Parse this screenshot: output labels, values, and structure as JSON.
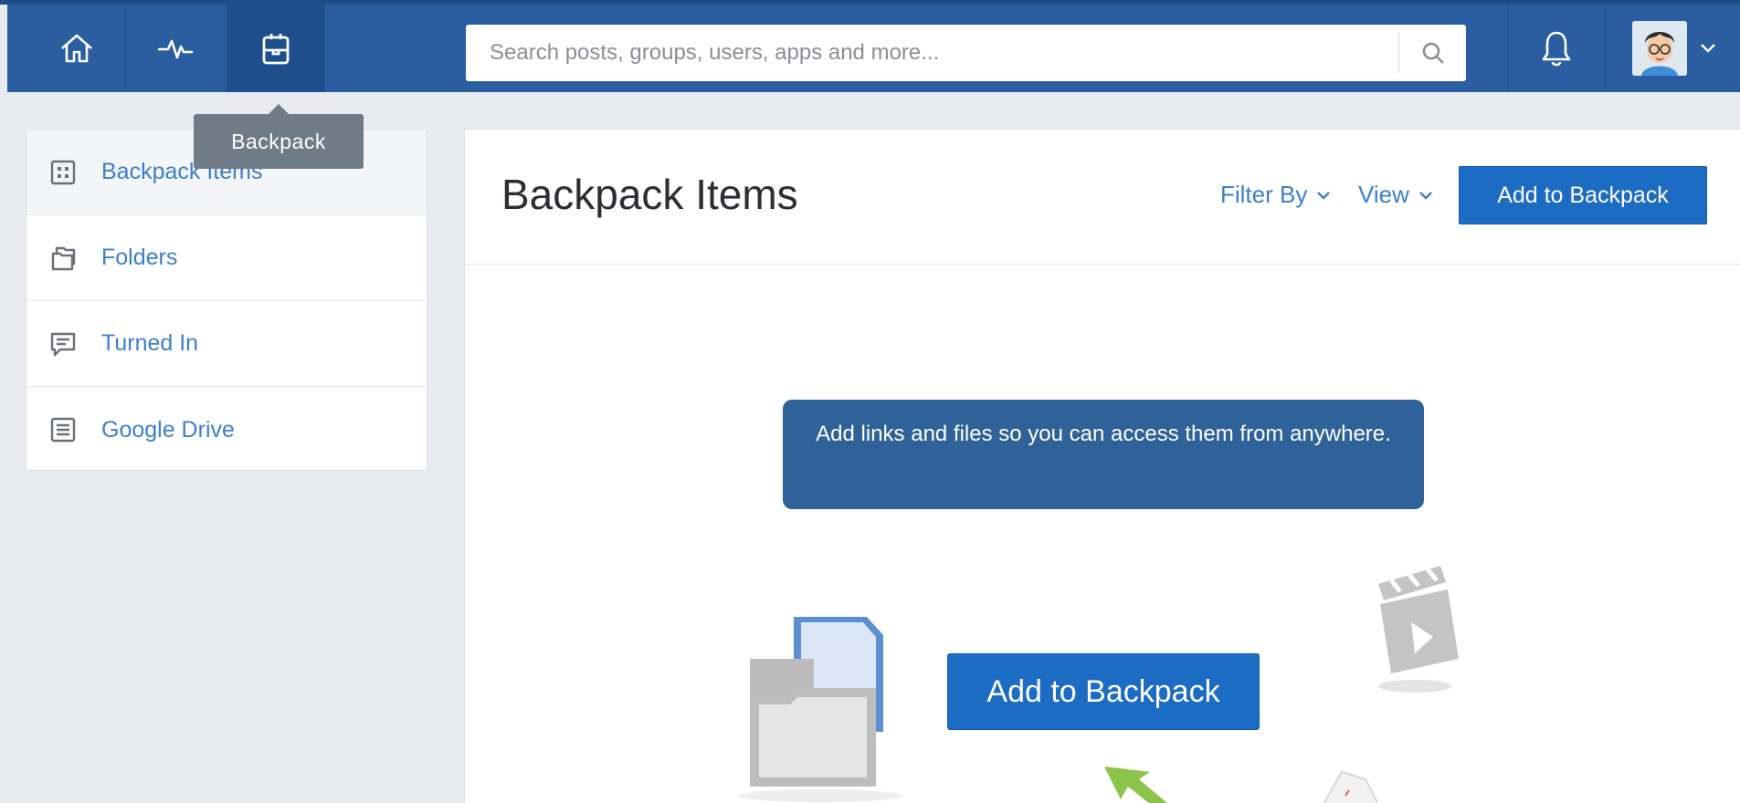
{
  "nav": {
    "items": [
      {
        "name": "home",
        "icon": "home-icon"
      },
      {
        "name": "activity",
        "icon": "activity-icon"
      },
      {
        "name": "backpack",
        "icon": "backpack-icon"
      }
    ],
    "tooltip": "Backpack"
  },
  "search": {
    "placeholder": "Search posts, groups, users, apps and more...",
    "icon": "search-icon"
  },
  "header_right": {
    "bell_icon": "bell-icon",
    "avatar": "user-avatar",
    "dropdown_icon": "chevron-down-icon"
  },
  "sidebar": {
    "items": [
      {
        "label": "Backpack Items",
        "icon": "grid-icon"
      },
      {
        "label": "Folders",
        "icon": "folders-icon"
      },
      {
        "label": "Turned In",
        "icon": "comment-icon"
      },
      {
        "label": "Google Drive",
        "icon": "document-icon"
      }
    ]
  },
  "main": {
    "title": "Backpack Items",
    "filter_label": "Filter By",
    "view_label": "View",
    "add_label": "Add to Backpack",
    "empty_message": "Add links and files so you can access them from anywhere.",
    "empty_button": "Add to Backpack"
  },
  "colors": {
    "topbar": "#2b5ea0",
    "accent": "#1c6cc4",
    "link": "#3d80c9",
    "banner": "#2f6299"
  }
}
